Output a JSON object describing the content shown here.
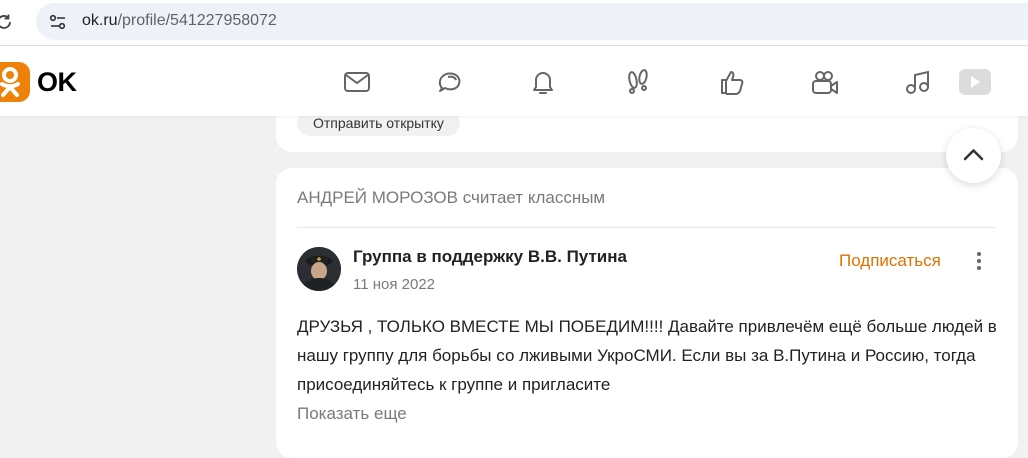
{
  "browser": {
    "url_domain": "ok.ru",
    "url_path": "/profile/541227958072"
  },
  "header": {
    "logo_text": "OK",
    "brand_color": "#ee8208",
    "nav_icons": [
      "messages-icon",
      "discussions-icon",
      "notifications-icon",
      "guests-icon",
      "events-icon",
      "video-calls-icon",
      "music-icon",
      "video-icon"
    ]
  },
  "prev_card": {
    "postcard_label": "Отправить открытку"
  },
  "post": {
    "activity_name": "АНДРЕЙ МОРОЗОВ",
    "activity_action": "считает классным",
    "group_name": "Группа в поддержку В.В. Путина",
    "date": "11 ноя 2022",
    "subscribe_label": "Подписаться",
    "subscribe_color": "#e07000",
    "text": "ДРУЗЬЯ , ТОЛЬКО ВМЕСТЕ МЫ ПОБЕДИМ!!!! Давайте привлечём ещё больше людей в нашу группу для борьбы со лживыми УкроСМИ. Если вы за В.Путина и Россию, тогда присоединяйтесь к группе и пригласите",
    "show_more_label": "Показать еще"
  }
}
